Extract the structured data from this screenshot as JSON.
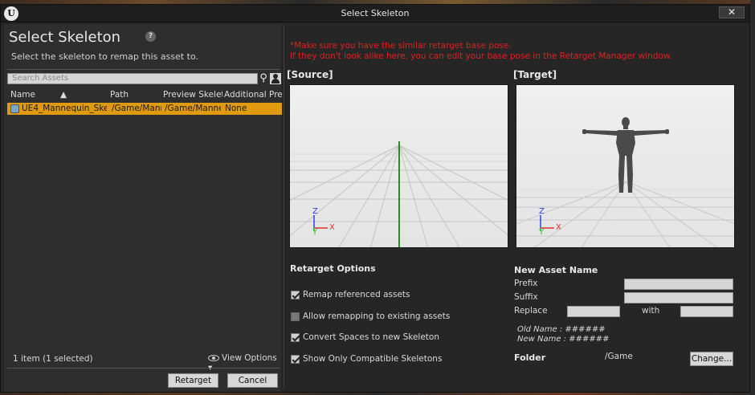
{
  "window": {
    "title": "Select Skeleton",
    "close_label": "✕",
    "logo": "U"
  },
  "left": {
    "heading": "Select Skeleton",
    "help": "?",
    "subtitle": "Select the skeleton to remap this asset to.",
    "search_placeholder": "Search Assets",
    "columns": [
      "Name",
      "Path",
      "Preview Skeleta",
      "Additional Prev"
    ],
    "rows": [
      {
        "name": "UE4_Mannequin_Skele",
        "path": "/Game/Manr",
        "preview": "/Game/Manne",
        "additional": "None",
        "selected": true
      }
    ],
    "item_count": "1 item (1 selected)",
    "view_options": "View Options",
    "retarget_label": "Retarget",
    "cancel_label": "Cancel"
  },
  "right": {
    "warning_line1": "*Make sure you have the similar retarget base pose.",
    "warning_line2": "If they don't look alike here, you can edit your base pose in the Retarget Manager window.",
    "source_label": "[Source]",
    "target_label": "[Target]",
    "axis_z": "Z",
    "axis_y": "Y",
    "axis_x": "X",
    "retarget_options_title": "Retarget Options",
    "options": [
      {
        "label": "Remap referenced assets",
        "checked": true
      },
      {
        "label": "Allow remapping to existing assets",
        "checked": false
      },
      {
        "label": "Convert Spaces to new Skeleton",
        "checked": true
      },
      {
        "label": "Show Only Compatible Skeletons",
        "checked": true
      }
    ],
    "new_asset_title": "New Asset Name",
    "prefix_label": "Prefix",
    "suffix_label": "Suffix",
    "replace_label": "Replace",
    "with_label": "with",
    "old_name": "Old Name : ######",
    "new_name": "New Name : ######",
    "folder_label": "Folder",
    "folder_value": "/Game",
    "change_label": "Change..."
  },
  "colors": {
    "selection": "#e09a10",
    "warning": "#e02020",
    "axis_x": "#e03030",
    "axis_y": "#30c030",
    "axis_z": "#3040e0"
  }
}
